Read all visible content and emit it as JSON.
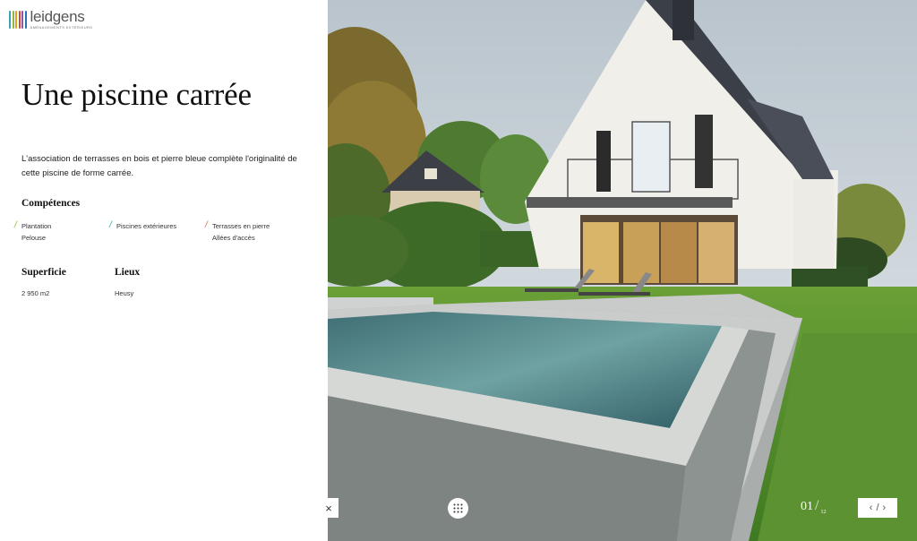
{
  "brand": {
    "name": "leidgens",
    "tagline": "AMÉNAGEMENTS EXTÉRIEURS",
    "bar_colors": [
      "#3aa4b4",
      "#8cb83c",
      "#e6a020",
      "#d0483a",
      "#8a5aa8",
      "#2d6fb4"
    ]
  },
  "project": {
    "title": "Une piscine carrée",
    "description": "L'association de terrasses en bois et pierre bleue complète l'originalité de cette piscine de forme carrée."
  },
  "competences": {
    "heading": "Compétences",
    "items": [
      {
        "line1": "Plantation",
        "line2": "Pelouse",
        "slash_color": "#8cb83c"
      },
      {
        "line1": "Piscines extérieures",
        "line2": "",
        "slash_color": "#3aa4b4"
      },
      {
        "line1": "Terrasses en pierre",
        "line2": "Allées d'accès",
        "slash_color": "#d0703a"
      }
    ]
  },
  "superficie": {
    "heading": "Superficie",
    "value": "2 950 m2"
  },
  "lieux": {
    "heading": "Lieux",
    "value": "Heusy"
  },
  "controls": {
    "close_icon": "×",
    "counter_current": "01",
    "counter_sep": "/",
    "counter_total": "12",
    "prev_icon": "‹",
    "nav_sep": "/",
    "next_icon": "›"
  }
}
